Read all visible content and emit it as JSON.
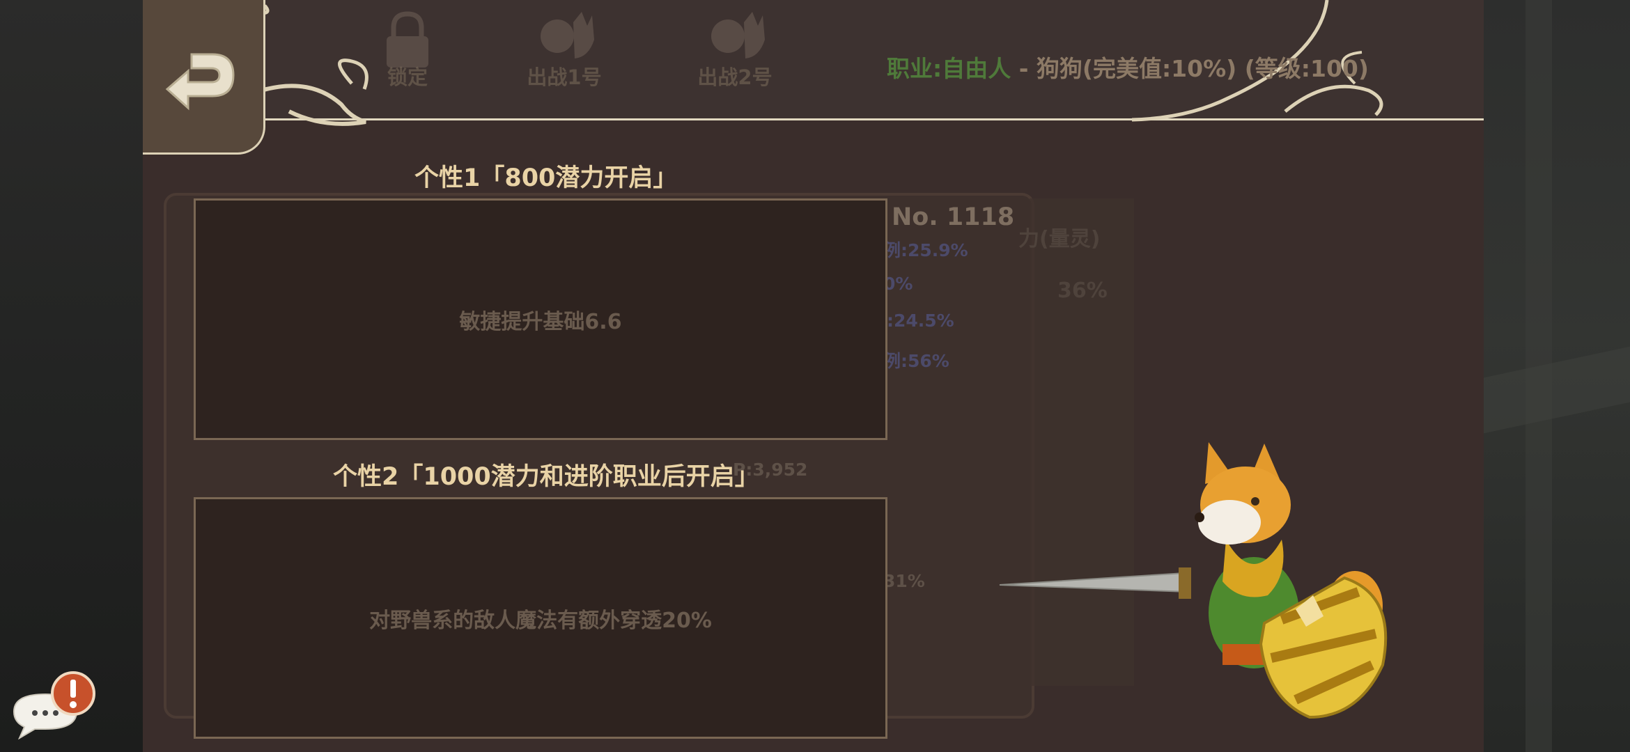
{
  "header": {
    "tabs": [
      {
        "label": "锁定",
        "icon": "lock-icon"
      },
      {
        "label": "出战1号",
        "icon": "character-portrait-icon"
      },
      {
        "label": "出战2号",
        "icon": "character-portrait-icon"
      }
    ],
    "job": {
      "label": "职业:自由人",
      "detail": "- 狗狗(完美值:10%) (等级:100)"
    },
    "back_icon": "return-arrow-icon"
  },
  "background_info": {
    "number": "No. 1118",
    "stat1": "例:25.9%",
    "stat2": "0%",
    "stat3": ":24.5%",
    "stat4": "例:56%",
    "stat5": "P:3,952",
    "stat6": "31%",
    "right_label": "力(量灵)",
    "right_value": "36%"
  },
  "personality1": {
    "title": "个性1「800潜力开启」",
    "text": "敏捷提升基础6.6"
  },
  "personality2": {
    "title": "个性2「1000潜力和进阶职业后开启」",
    "text": "对野兽系的敌人魔法有额外穿透20%"
  },
  "chat_icon": "chat-alert-icon",
  "colors": {
    "accent_title": "#e9d3a6",
    "job_green": "#4f7a3a",
    "frame_line": "#e2d9c0"
  }
}
